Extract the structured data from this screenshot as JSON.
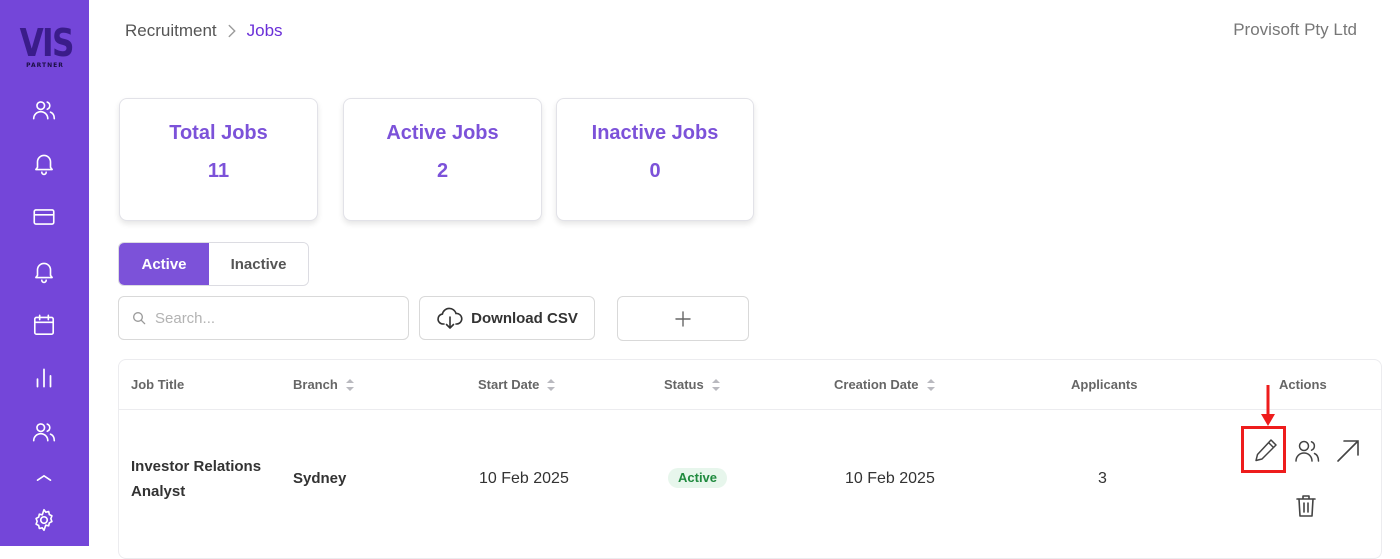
{
  "sidebar": {
    "logo_text": "VIS",
    "logo_sub": "PARTNER",
    "icons": [
      "users-icon",
      "bell-icon",
      "credit-card-icon",
      "bell-icon",
      "calendar-icon",
      "bar-chart-icon",
      "users-icon",
      "chevron-up-icon",
      "settings-icon"
    ],
    "accent": "#7446d9"
  },
  "header": {
    "breadcrumb_root": "Recruitment",
    "breadcrumb_current": "Jobs",
    "company": "Provisoft Pty Ltd"
  },
  "stats": [
    {
      "label": "Total Jobs",
      "value": "11"
    },
    {
      "label": "Active Jobs",
      "value": "2"
    },
    {
      "label": "Inactive Jobs",
      "value": "0"
    }
  ],
  "toggle": {
    "active": "Active",
    "inactive": "Inactive",
    "selected": "Active"
  },
  "toolbar": {
    "search_placeholder": "Search...",
    "download_label": "Download CSV",
    "add_icon": "plus-icon"
  },
  "table": {
    "headers": [
      "Job Title",
      "Branch",
      "Start Date",
      "Status",
      "Creation Date",
      "Applicants",
      "Actions"
    ],
    "rows": [
      {
        "title_line1": "Investor Relations",
        "title_line2": "Analyst",
        "branch": "Sydney",
        "start_date": "10 Feb 2025",
        "status": "Active",
        "creation_date": "10 Feb 2025",
        "applicants": "3",
        "actions": [
          "edit-icon",
          "applicants-icon",
          "open-icon",
          "delete-icon"
        ]
      }
    ]
  },
  "colors": {
    "brand": "#7c52d9",
    "highlight": "#ee1c1c",
    "status_active_bg": "#e7f6ec",
    "status_active_text": "#1f8a3e"
  }
}
